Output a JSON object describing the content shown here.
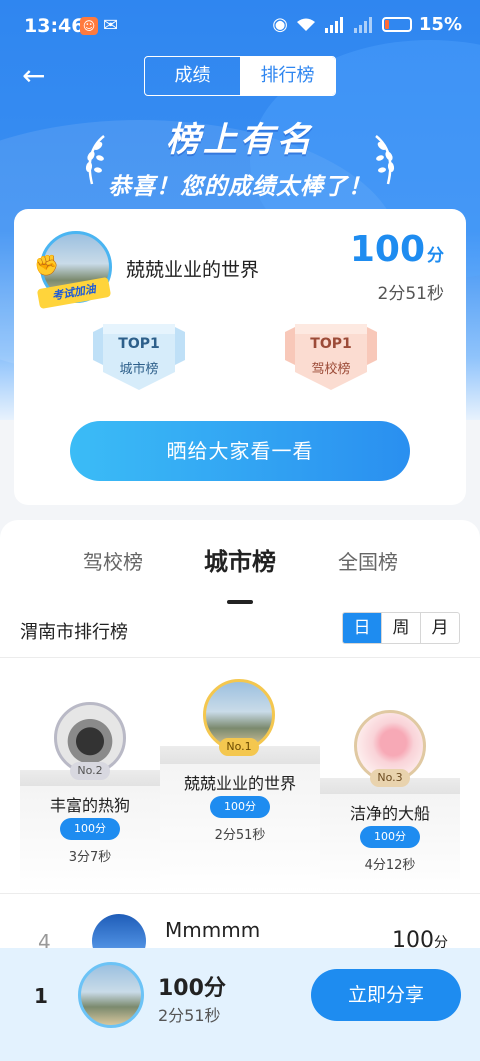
{
  "status_bar": {
    "time": "13:46",
    "battery_percent": "15%",
    "battery_level": 0.15
  },
  "header": {
    "tabs": [
      {
        "label": "成绩",
        "active": false
      },
      {
        "label": "排行榜",
        "active": true
      }
    ]
  },
  "banner": {
    "title": "榜上有名",
    "subtitle": "恭喜！您的成绩太棒了！"
  },
  "score_card": {
    "user_name": "兢兢业业的世界",
    "avatar_badge": "考试加油",
    "score": "100",
    "score_unit": "分",
    "time": "2分51秒",
    "badges": [
      {
        "top": "TOP1",
        "label": "城市榜"
      },
      {
        "top": "TOP1",
        "label": "驾校榜"
      }
    ],
    "share_label": "晒给大家看一看"
  },
  "board": {
    "tabs": [
      "驾校榜",
      "城市榜",
      "全国榜"
    ],
    "active_tab": "城市榜",
    "title": "渭南市排行榜",
    "periods": [
      "日",
      "周",
      "月"
    ],
    "active_period": "日",
    "podium": [
      {
        "rank": "No.1",
        "name": "兢兢业业的世界",
        "score": "100分",
        "time": "2分51秒"
      },
      {
        "rank": "No.2",
        "name": "丰富的热狗",
        "score": "100分",
        "time": "3分7秒"
      },
      {
        "rank": "No.3",
        "name": "洁净的大船",
        "score": "100分",
        "time": "4分12秒"
      }
    ],
    "rows": [
      {
        "rank": "4",
        "name": "Mmmmm",
        "score": "100",
        "unit": "分"
      }
    ]
  },
  "bottom_bar": {
    "rank": "1",
    "score": "100分",
    "time": "2分51秒",
    "share_label": "立即分享"
  },
  "colors": {
    "primary": "#1e8cf0",
    "hero": "#2f86f0",
    "bottom_bg": "#e3f2fe"
  }
}
